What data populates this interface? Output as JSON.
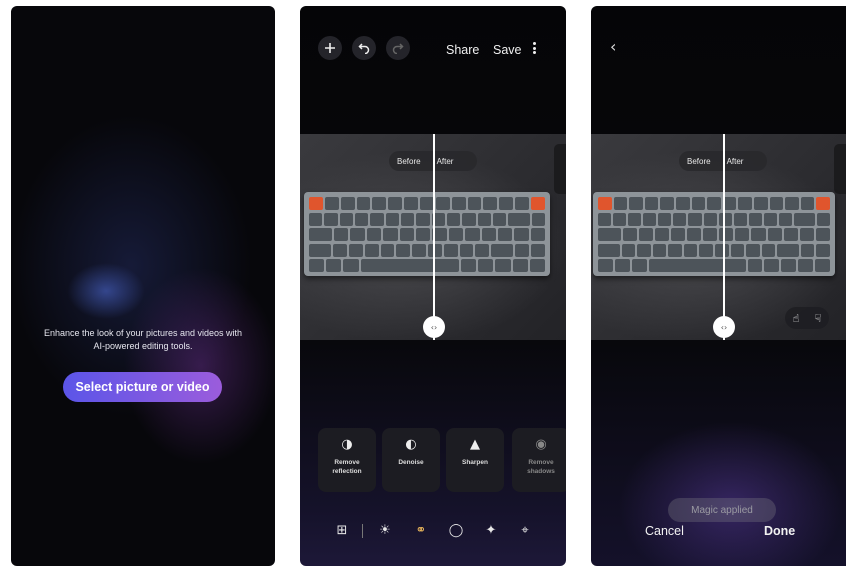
{
  "screen1": {
    "intro_text": "Enhance the look of your pictures and videos with AI-powered editing tools.",
    "select_button": "Select picture or video"
  },
  "screen2": {
    "top_bar": {
      "add_icon": "plus-icon",
      "undo_icon": "undo-icon",
      "redo_icon": "redo-icon",
      "share_label": "Share",
      "save_label": "Save",
      "more_icon": "kebab-icon"
    },
    "compare": {
      "before_label": "Before",
      "after_label": "After"
    },
    "tools": [
      {
        "icon": "remove-reflection-icon",
        "label": "Remove reflection"
      },
      {
        "icon": "denoise-icon",
        "label": "Denoise"
      },
      {
        "icon": "sharpen-icon",
        "label": "Sharpen"
      },
      {
        "icon": "remove-shadows-icon",
        "label": "Remove shadows"
      }
    ],
    "bottom_toolbar": [
      "transform-icon",
      "brightness-icon",
      "filter-icon",
      "portrait-icon",
      "ai-effects-icon",
      "crop-icon"
    ]
  },
  "screen3": {
    "back_icon": "back-chevron-icon",
    "compare": {
      "before_label": "Before",
      "after_label": "After"
    },
    "feedback": [
      "thumbs-up-icon",
      "thumbs-down-icon"
    ],
    "toast": "Magic applied",
    "cancel_label": "Cancel",
    "done_label": "Done"
  },
  "colors": {
    "accent_gradient_start": "#5b55e8",
    "accent_gradient_end": "#9b5cdc",
    "background": "#050507",
    "keycap_accent": "#e0552d"
  }
}
